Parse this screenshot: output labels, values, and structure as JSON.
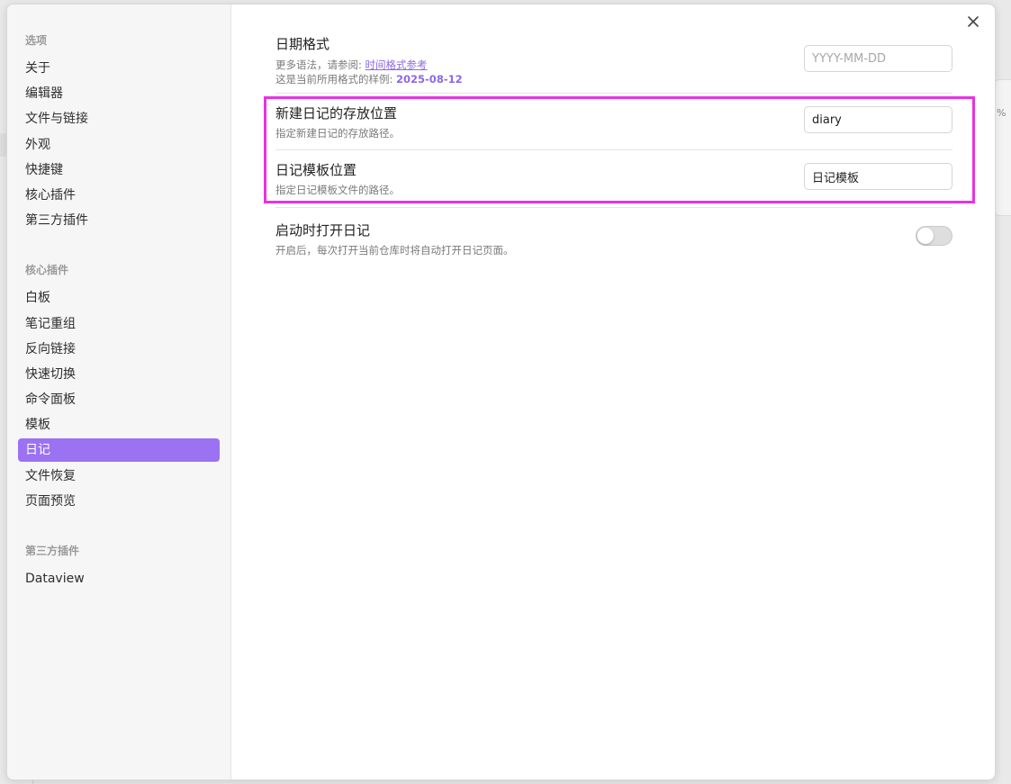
{
  "sidebar": {
    "groups": [
      {
        "title": "选项",
        "items": [
          "关于",
          "编辑器",
          "文件与链接",
          "外观",
          "快捷键",
          "核心插件",
          "第三方插件"
        ]
      },
      {
        "title": "核心插件",
        "items": [
          "白板",
          "笔记重组",
          "反向链接",
          "快速切换",
          "命令面板",
          "模板",
          "日记",
          "文件恢复",
          "页面预览"
        ]
      },
      {
        "title": "第三方插件",
        "items": [
          "Dataview"
        ]
      }
    ],
    "active_item": "日记"
  },
  "settings": {
    "date_format": {
      "name": "日期格式",
      "desc_prefix": "更多语法，请参阅: ",
      "desc_link": "时间格式参考",
      "sample_prefix": "这是当前所用格式的样例: ",
      "sample_value": "2025-08-12",
      "input_placeholder": "YYYY-MM-DD"
    },
    "new_file_location": {
      "name": "新建日记的存放位置",
      "desc": "指定新建日记的存放路径。",
      "input_value": "diary"
    },
    "template_location": {
      "name": "日记模板位置",
      "desc": "指定日记模板文件的路径。",
      "input_value": "日记模板"
    },
    "open_on_start": {
      "name": "启动时打开日记",
      "desc": "开启后，每次打开当前仓库时将自动打开日记页面。",
      "enabled": false
    }
  },
  "colors": {
    "accent": "#9b72f2",
    "highlight_box": "#e832e2"
  },
  "background_fragment": "%"
}
